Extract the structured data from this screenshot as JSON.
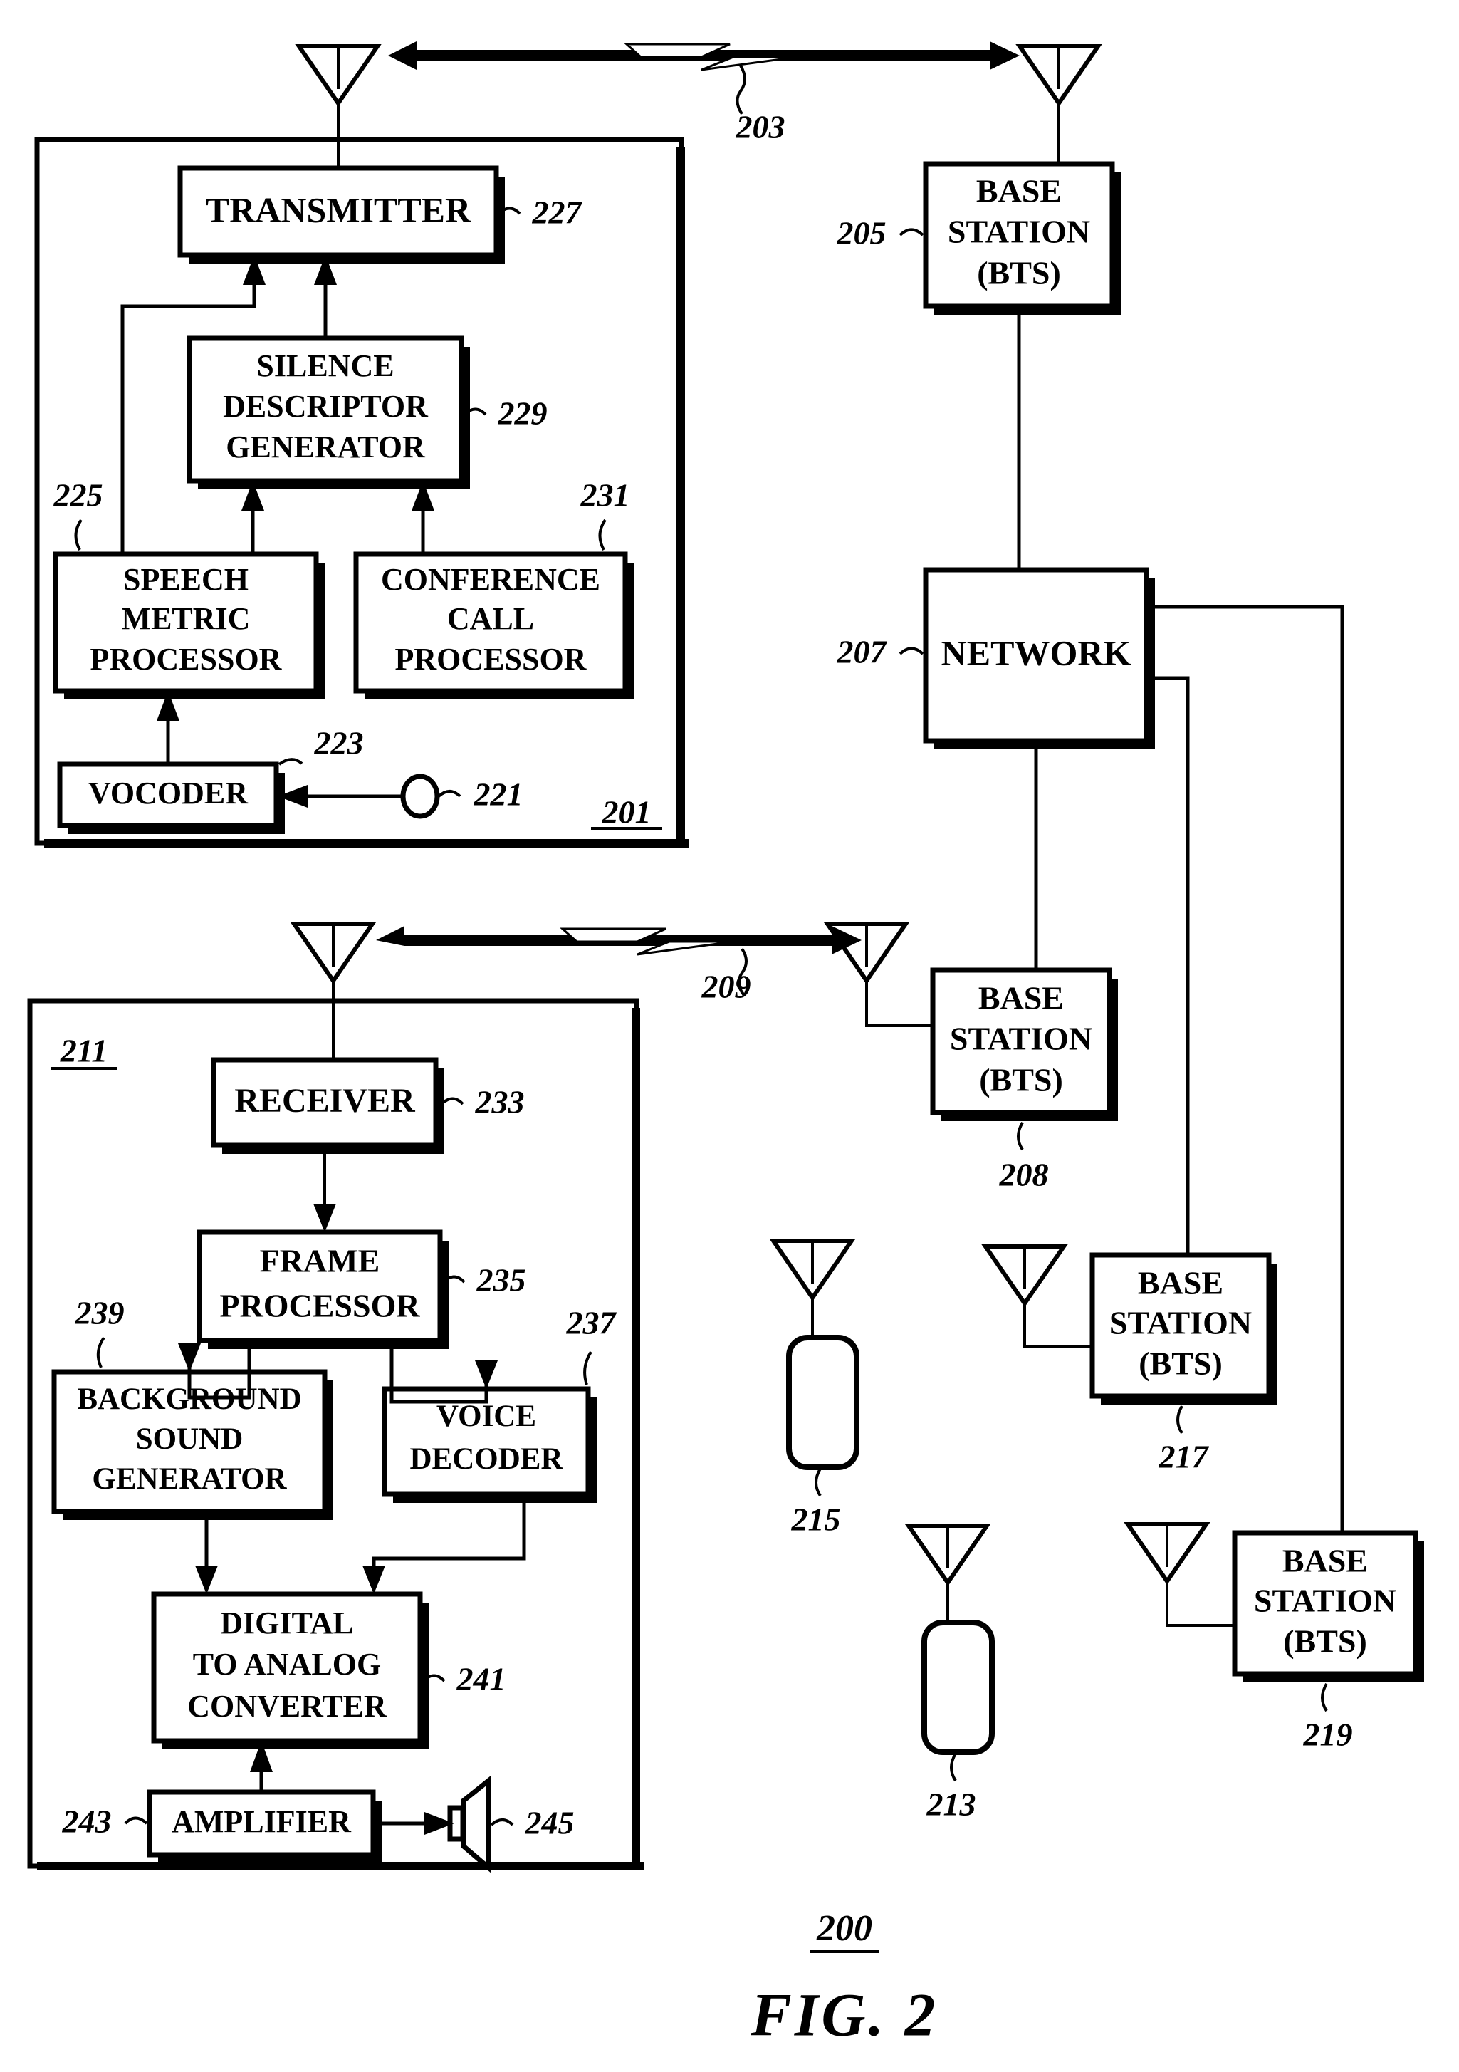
{
  "figure": {
    "title": "FIG. 2",
    "system_ref": "200"
  },
  "blocks": {
    "transmitter": {
      "label": "TRANSMITTER",
      "ref": "227"
    },
    "silence_descriptor": {
      "label": "SILENCE DESCRIPTOR GENERATOR",
      "line1": "SILENCE",
      "line2": "DESCRIPTOR",
      "line3": "GENERATOR",
      "ref": "229"
    },
    "speech_metric": {
      "label": "SPEECH METRIC PROCESSOR",
      "line1": "SPEECH",
      "line2": "METRIC",
      "line3": "PROCESSOR",
      "ref": "225"
    },
    "conference_call": {
      "label": "CONFERENCE CALL PROCESSOR",
      "line1": "CONFERENCE",
      "line2": "CALL",
      "line3": "PROCESSOR",
      "ref": "231"
    },
    "vocoder": {
      "label": "VOCODER",
      "ref": "223"
    },
    "microphone": {
      "label": "",
      "ref": "221"
    },
    "receiver": {
      "label": "RECEIVER",
      "ref": "233"
    },
    "frame_processor": {
      "label": "FRAME PROCESSOR",
      "line1": "FRAME",
      "line2": "PROCESSOR",
      "ref": "235"
    },
    "background_sound": {
      "label": "BACKGROUND SOUND GENERATOR",
      "line1": "BACKGROUND",
      "line2": "SOUND",
      "line3": "GENERATOR",
      "ref": "239"
    },
    "voice_decoder": {
      "label": "VOICE DECODER",
      "line1": "VOICE",
      "line2": "DECODER",
      "ref": "237"
    },
    "dac": {
      "label": "DIGITAL TO ANALOG CONVERTER",
      "line1": "DIGITAL",
      "line2": "TO ANALOG",
      "line3": "CONVERTER",
      "ref": "241"
    },
    "amplifier": {
      "label": "AMPLIFIER",
      "ref": "243"
    },
    "speaker": {
      "label": "",
      "ref": "245"
    },
    "network": {
      "label": "NETWORK",
      "ref": "207"
    },
    "bts_205": {
      "line1": "BASE",
      "line2": "STATION",
      "line3": "(BTS)",
      "ref": "205"
    },
    "bts_208": {
      "line1": "BASE",
      "line2": "STATION",
      "line3": "(BTS)",
      "ref": "208"
    },
    "bts_217": {
      "line1": "BASE",
      "line2": "STATION",
      "line3": "(BTS)",
      "ref": "217"
    },
    "bts_219": {
      "line1": "BASE",
      "line2": "STATION",
      "line3": "(BTS)",
      "ref": "219"
    }
  },
  "enclosures": {
    "transmit_unit": {
      "ref": "201"
    },
    "receive_unit": {
      "ref": "211"
    }
  },
  "mobiles": {
    "mobile_215": {
      "ref": "215"
    },
    "mobile_213": {
      "ref": "213"
    }
  },
  "links": {
    "link_203": {
      "ref": "203"
    },
    "link_209": {
      "ref": "209"
    }
  },
  "colors": {
    "ink": "#000000",
    "paper": "#ffffff"
  }
}
